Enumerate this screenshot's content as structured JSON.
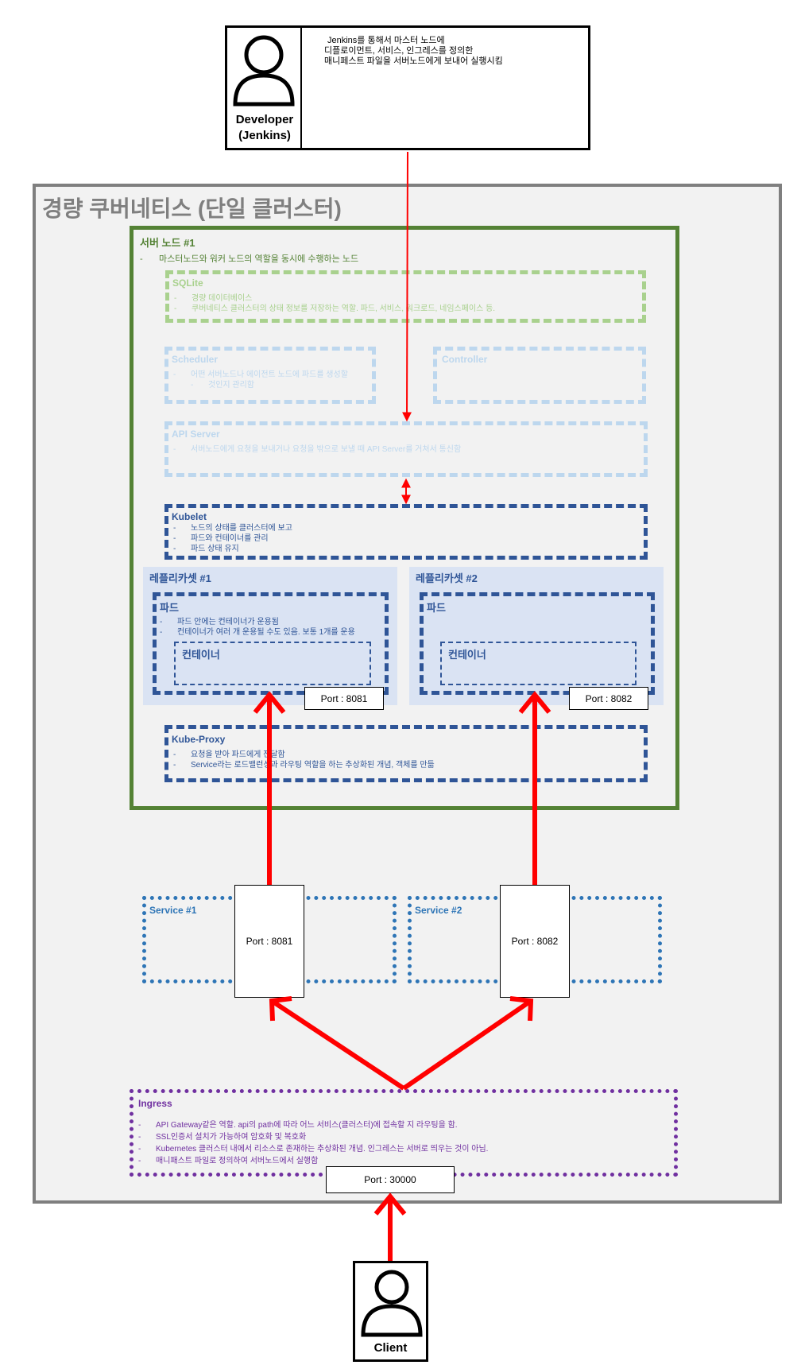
{
  "developer": {
    "label_line1": "Developer",
    "label_line2": "(Jenkins)",
    "note_line1": "Jenkins를 통해서 마스터 노드에",
    "note_line2": "디플로이먼트, 서비스, 인그레스를 정의한",
    "note_line3": "매니페스트 파일을 서버노드에게 보내어 실행시킴",
    "icon": "person-icon"
  },
  "cluster": {
    "title": "경량 쿠버네티스 (단일 클러스터)"
  },
  "server_node": {
    "title": "서버 노드 #1",
    "desc": "마스터노드와 워커 노드의 역할을 동시에 수행하는 노드"
  },
  "sqlite": {
    "title": "SQLite",
    "items": [
      "경량 데이터베이스",
      "쿠버네티스 클러스터의 상태 정보를 저장하는 역할. 파드, 서비스, 워크로드, 네임스페이스 등."
    ]
  },
  "scheduler": {
    "title": "Scheduler",
    "items": [
      "어떤 서버노드나 에이전트 노드에 파드를 생성할",
      "것인지 관리함"
    ]
  },
  "controller": {
    "title": "Controller"
  },
  "api_server": {
    "title": "API Server",
    "items": [
      "서버노드에게 요청을 보내거나 요청을 밖으로 보낼 때 API Server를 거쳐서 통신함"
    ]
  },
  "kubelet": {
    "title": "Kubelet",
    "items": [
      "노드의 상태를 클러스터에 보고",
      "파드와 컨테이너를 관리",
      "파드 상태 유지"
    ]
  },
  "replicaset1": {
    "title": "레플리카셋 #1",
    "pod_title": "파드",
    "pod_items": [
      "파드 안에는 컨테이너가 운용됨",
      "컨테이너가 여러 개 운용될 수도 있음. 보통 1개를 운용"
    ],
    "container": "컨테이너",
    "port": "Port : 8081"
  },
  "replicaset2": {
    "title": "레플리카셋 #2",
    "pod_title": "파드",
    "container": "컨테이너",
    "port": "Port : 8082"
  },
  "kube_proxy": {
    "title": "Kube-Proxy",
    "items": [
      "요청을 받아 파드에게 전달함",
      "Service라는 로드밸런싱과 라우팅 역할을 하는 추상화된 개념, 객체를 만듦"
    ]
  },
  "service1": {
    "title": "Service #1",
    "port": "Port : 8081"
  },
  "service2": {
    "title": "Service #2",
    "port": "Port : 8082"
  },
  "ingress": {
    "title": "Ingress",
    "items": [
      "API Gateway같은 역할. api의 path에 따라 어느 서비스(클러스터)에 접속할 지 라우팅을 함.",
      "SSL인증서 설치가 가능하여 암호화 및 복호화",
      "Kubernetes 클러스터 내에서 리소스로 존재하는 추상화된 개념. 인그레스는 서버로 띄우는 것이 아님.",
      "매니패스트 파일로 정의하여 서버노드에서 실행함"
    ],
    "port": "Port : 30000"
  },
  "client": {
    "label": "Client",
    "icon": "person-icon"
  },
  "colors": {
    "arrow": "#ff0000",
    "cluster_border": "#7f7f7f",
    "server_border": "#548235",
    "sqlite_border": "#a9d18e",
    "light_blue": "#bdd7ee",
    "navy": "#2f5597",
    "service_border": "#2e75b6",
    "ingress_border": "#7030a0",
    "replicaset_bg": "#dae3f3"
  }
}
